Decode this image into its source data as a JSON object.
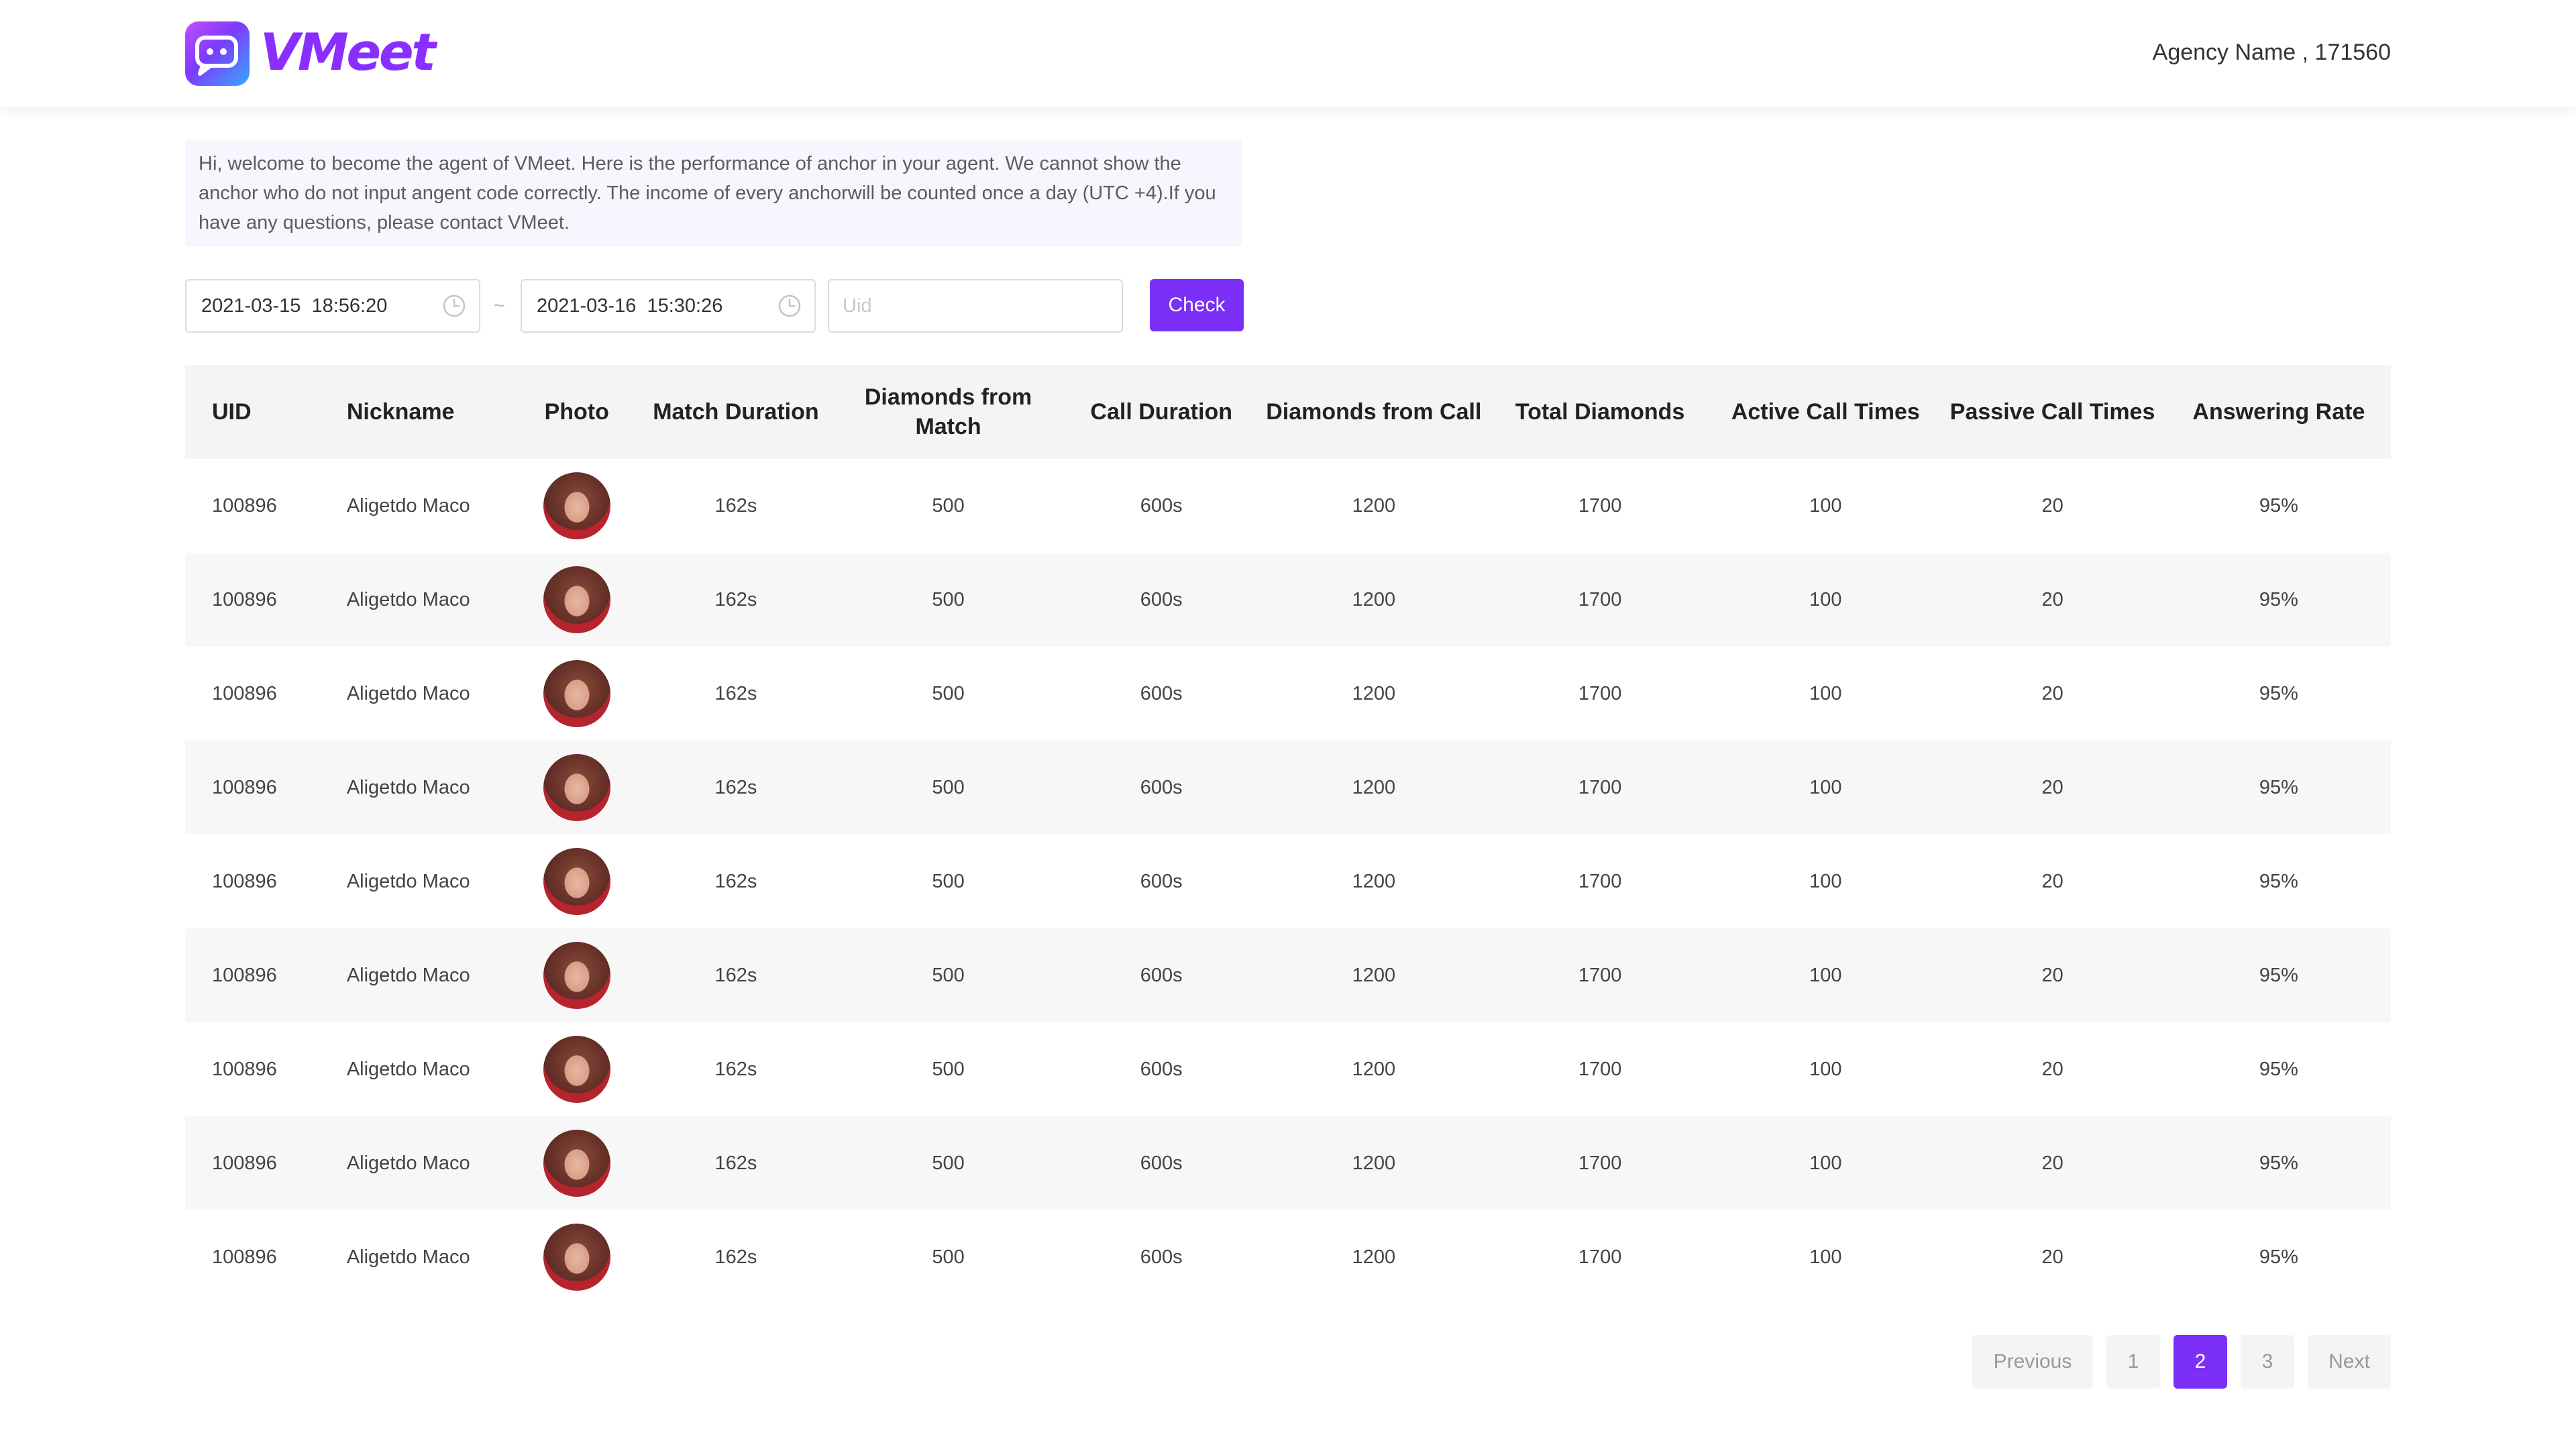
{
  "header": {
    "logo_text": "VMeet",
    "agency_label": "Agency Name , 171560"
  },
  "notice": {
    "text": "Hi, welcome to become the agent of VMeet. Here is the performance of anchor in your agent. We cannot show the anchor who do not input angent code correctly. The income of every anchorwill be counted once a day (UTC +4).If you have any questions, please contact  VMeet."
  },
  "filters": {
    "start_date": "2021-03-15  18:56:20",
    "separator": "~",
    "end_date": "2021-03-16  15:30:26",
    "uid_placeholder": "Uid",
    "uid_value": "",
    "check_label": "Check"
  },
  "table": {
    "columns": [
      "UID",
      "Nickname",
      "Photo",
      "Match Duration",
      "Diamonds from Match",
      "Call Duration",
      "Diamonds from Call",
      "Total Diamonds",
      "Active Call Times",
      "Passive Call Times",
      "Answering Rate"
    ],
    "rows": [
      {
        "uid": "100896",
        "nickname": "Aligetdo Maco",
        "match_duration": "162s",
        "diamonds_match": "500",
        "call_duration": "600s",
        "diamonds_call": "1200",
        "total_diamonds": "1700",
        "active_calls": "100",
        "passive_calls": "20",
        "answering_rate": "95%"
      },
      {
        "uid": "100896",
        "nickname": "Aligetdo Maco",
        "match_duration": "162s",
        "diamonds_match": "500",
        "call_duration": "600s",
        "diamonds_call": "1200",
        "total_diamonds": "1700",
        "active_calls": "100",
        "passive_calls": "20",
        "answering_rate": "95%"
      },
      {
        "uid": "100896",
        "nickname": "Aligetdo Maco",
        "match_duration": "162s",
        "diamonds_match": "500",
        "call_duration": "600s",
        "diamonds_call": "1200",
        "total_diamonds": "1700",
        "active_calls": "100",
        "passive_calls": "20",
        "answering_rate": "95%"
      },
      {
        "uid": "100896",
        "nickname": "Aligetdo Maco",
        "match_duration": "162s",
        "diamonds_match": "500",
        "call_duration": "600s",
        "diamonds_call": "1200",
        "total_diamonds": "1700",
        "active_calls": "100",
        "passive_calls": "20",
        "answering_rate": "95%"
      },
      {
        "uid": "100896",
        "nickname": "Aligetdo Maco",
        "match_duration": "162s",
        "diamonds_match": "500",
        "call_duration": "600s",
        "diamonds_call": "1200",
        "total_diamonds": "1700",
        "active_calls": "100",
        "passive_calls": "20",
        "answering_rate": "95%"
      },
      {
        "uid": "100896",
        "nickname": "Aligetdo Maco",
        "match_duration": "162s",
        "diamonds_match": "500",
        "call_duration": "600s",
        "diamonds_call": "1200",
        "total_diamonds": "1700",
        "active_calls": "100",
        "passive_calls": "20",
        "answering_rate": "95%"
      },
      {
        "uid": "100896",
        "nickname": "Aligetdo Maco",
        "match_duration": "162s",
        "diamonds_match": "500",
        "call_duration": "600s",
        "diamonds_call": "1200",
        "total_diamonds": "1700",
        "active_calls": "100",
        "passive_calls": "20",
        "answering_rate": "95%"
      },
      {
        "uid": "100896",
        "nickname": "Aligetdo Maco",
        "match_duration": "162s",
        "diamonds_match": "500",
        "call_duration": "600s",
        "diamonds_call": "1200",
        "total_diamonds": "1700",
        "active_calls": "100",
        "passive_calls": "20",
        "answering_rate": "95%"
      },
      {
        "uid": "100896",
        "nickname": "Aligetdo Maco",
        "match_duration": "162s",
        "diamonds_match": "500",
        "call_duration": "600s",
        "diamonds_call": "1200",
        "total_diamonds": "1700",
        "active_calls": "100",
        "passive_calls": "20",
        "answering_rate": "95%"
      }
    ]
  },
  "pagination": {
    "previous_label": "Previous",
    "pages": [
      "1",
      "2",
      "3"
    ],
    "current_page": "2",
    "next_label": "Next"
  },
  "colors": {
    "accent": "#7b2ff7",
    "logo_gradient": [
      "#c54dff",
      "#7b3bff",
      "#37a9ff"
    ],
    "row_stripe": "#f7f7f7",
    "header_row": "#f4f4f4"
  },
  "icons": {
    "logo": "chat-bubble-icon",
    "date_picker": "clock-icon",
    "photo": "avatar"
  }
}
